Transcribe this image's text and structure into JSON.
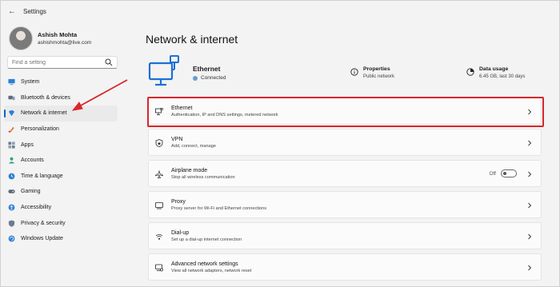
{
  "window": {
    "title": "Settings"
  },
  "user": {
    "name": "Ashish Mohta",
    "email": "ashishmohta@live.com"
  },
  "search": {
    "placeholder": "Find a setting"
  },
  "nav": [
    {
      "label": "System",
      "icon": "system-icon"
    },
    {
      "label": "Bluetooth & devices",
      "icon": "bluetooth-icon"
    },
    {
      "label": "Network & internet",
      "icon": "network-icon",
      "active": true
    },
    {
      "label": "Personalization",
      "icon": "personalization-icon"
    },
    {
      "label": "Apps",
      "icon": "apps-icon"
    },
    {
      "label": "Accounts",
      "icon": "accounts-icon"
    },
    {
      "label": "Time & language",
      "icon": "time-language-icon"
    },
    {
      "label": "Gaming",
      "icon": "gaming-icon"
    },
    {
      "label": "Accessibility",
      "icon": "accessibility-icon"
    },
    {
      "label": "Privacy & security",
      "icon": "privacy-icon"
    },
    {
      "label": "Windows Update",
      "icon": "windows-update-icon"
    }
  ],
  "main": {
    "title": "Network & internet",
    "overview": {
      "name": "Ethernet",
      "status": "Connected",
      "properties": {
        "title": "Properties",
        "sub": "Public network"
      },
      "usage": {
        "title": "Data usage",
        "sub": "6.45 GB, last 30 days"
      }
    },
    "cards": [
      {
        "title": "Ethernet",
        "sub": "Authentication, IP and DNS settings, metered network",
        "icon": "ethernet-icon",
        "highlighted": true
      },
      {
        "title": "VPN",
        "sub": "Add, connect, manage",
        "icon": "vpn-shield-icon"
      },
      {
        "title": "Airplane mode",
        "sub": "Stop all wireless communication",
        "icon": "airplane-icon",
        "toggle": "Off"
      },
      {
        "title": "Proxy",
        "sub": "Proxy server for Wi-Fi and Ethernet connections",
        "icon": "proxy-icon"
      },
      {
        "title": "Dial-up",
        "sub": "Set up a dial-up internet connection",
        "icon": "dialup-icon"
      },
      {
        "title": "Advanced network settings",
        "sub": "View all network adapters, network reset",
        "icon": "advanced-network-icon"
      }
    ]
  },
  "colors": {
    "accent": "#0067c0",
    "highlight": "#d9262c",
    "arrow": "#d9262c"
  }
}
